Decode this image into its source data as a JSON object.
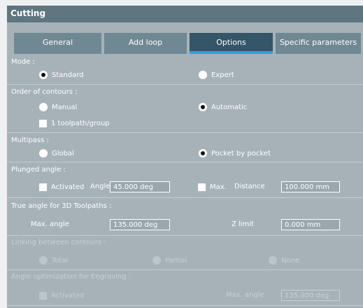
{
  "window": {
    "title": "Cutting"
  },
  "tabs": [
    {
      "label": "General"
    },
    {
      "label": "Add loop"
    },
    {
      "label": "Options",
      "active": true
    },
    {
      "label": "Specific parameters"
    }
  ],
  "mode": {
    "label": "Mode :",
    "standard": "Standard",
    "expert": "Expert",
    "selected": "Standard"
  },
  "order": {
    "label": "Order of contours :",
    "manual": "Manual",
    "automatic": "Automatic",
    "selected": "Automatic",
    "toolpath_group": "1 toolpath/group",
    "toolpath_group_checked": false
  },
  "multipass": {
    "label": "Multipass :",
    "global": "Global",
    "pocket": "Pocket by pocket",
    "selected": "Pocket by pocket"
  },
  "plunged": {
    "label": "Plunged angle :",
    "activated": "Activated",
    "activated_checked": false,
    "angle_label": "Angle",
    "angle_value": "45.000 deg",
    "max_label": "Max.",
    "max_checked": false,
    "distance_label": "Distance",
    "distance_value": "100.000 mm"
  },
  "true_angle": {
    "label": "True angle for 3D Toolpaths  :",
    "max_angle_label": "Max. angle",
    "max_angle_value": "135.000 deg",
    "z_limit_label": "Z limit",
    "z_limit_value": "0.000 mm"
  },
  "linking": {
    "label": "Linking between contours :",
    "total": "Total",
    "partial": "Partial",
    "none": "None",
    "enabled": false
  },
  "engraving": {
    "label": "Angle optimization for Engraving :",
    "activated": "Activated",
    "max_angle_label": "Max. angle",
    "max_angle_value": "135.000 deg",
    "enabled": false
  },
  "colors": {
    "title_bg": "#5f7580",
    "panel_bg": "#a6b2b8",
    "tab_bg": "#6f8893",
    "tab_active_bg": "#355569",
    "tab_underline": "#2d9ee4"
  }
}
